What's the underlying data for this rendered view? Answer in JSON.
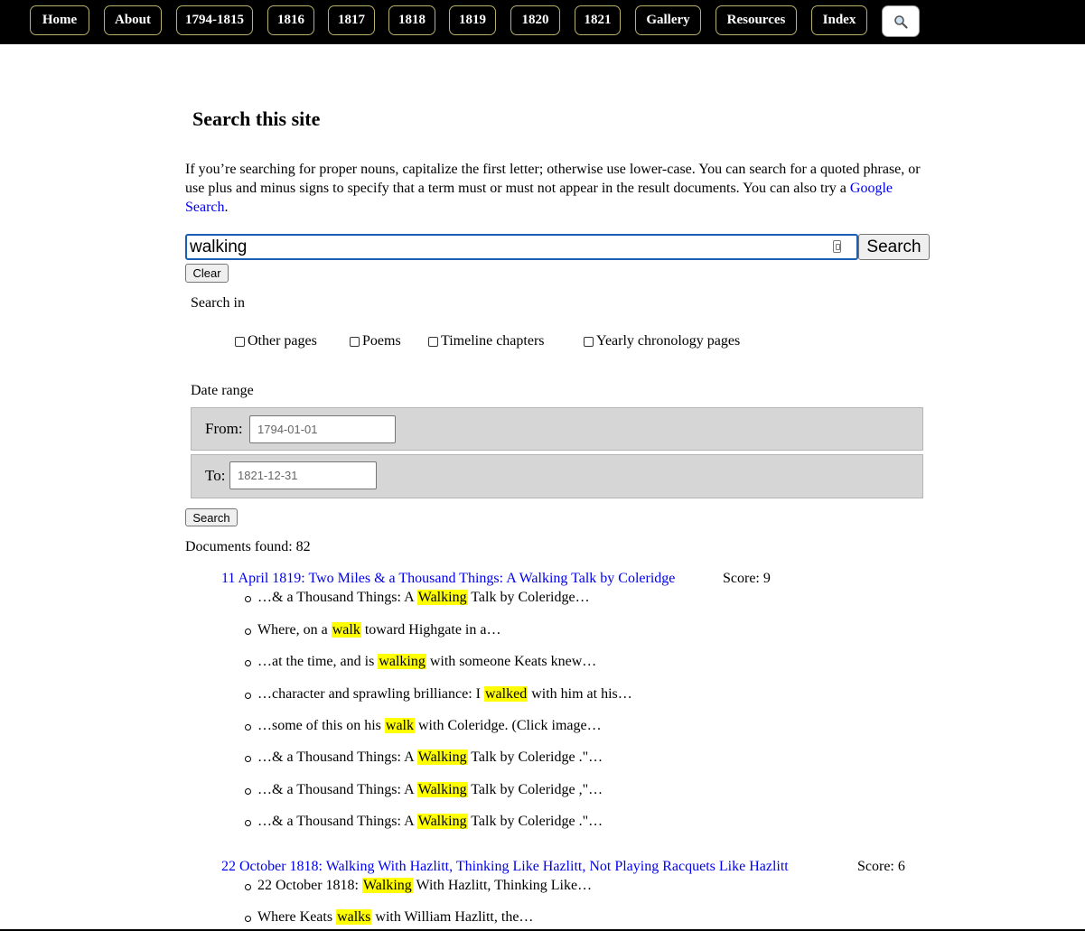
{
  "nav": {
    "items": [
      "Home",
      "About",
      "1794-1815",
      "1816",
      "1817",
      "1818",
      "1819",
      "1820",
      "1821",
      "Gallery",
      "Resources",
      "Index"
    ],
    "search_icon": "magnifier-icon"
  },
  "page": {
    "heading": "Search this site",
    "intro_text": "If you’re searching for proper nouns, capitalize the first letter; otherwise use lower-case. You can search for a quoted phrase, or use plus and minus signs to specify that a term must or must not appear in the result documents. You can also try a ",
    "intro_link": "Google Search",
    "intro_end": "."
  },
  "search": {
    "query": "walking",
    "search_button": "Search",
    "clear_button": "Clear"
  },
  "filters": {
    "search_in_label": "Search in",
    "options": [
      "Other pages",
      "Poems",
      "Timeline chapters",
      "Yearly chronology pages"
    ],
    "date_range_label": "Date range",
    "from_label": "From:",
    "from_placeholder": "1794-01-01",
    "to_label": "To:",
    "to_placeholder": "1821-12-31",
    "submit_button": "Search"
  },
  "results": {
    "count_text": "Documents found: 82",
    "items": [
      {
        "title": "11 April 1819: Two Miles & a Thousand Things: A Walking Talk by Coleridge",
        "score": "Score: 9",
        "snippets": [
          {
            "pre": "…& a Thousand Things: A ",
            "hit": "Walking",
            "post": " Talk by Coleridge…"
          },
          {
            "pre": "Where, on a ",
            "hit": "walk",
            "post": " toward Highgate in a…"
          },
          {
            "pre": "…at the time, and is ",
            "hit": "walking",
            "post": " with someone Keats knew…"
          },
          {
            "pre": "…character and sprawling brilliance: I ",
            "hit": "walked",
            "post": " with him at his…"
          },
          {
            "pre": "…some of this on his ",
            "hit": "walk",
            "post": " with Coleridge. (Click image…"
          },
          {
            "pre": "…& a Thousand Things: A ",
            "hit": "Walking",
            "post": " Talk by Coleridge .\"…"
          },
          {
            "pre": "…& a Thousand Things: A ",
            "hit": "Walking",
            "post": " Talk by Coleridge ,\"…"
          },
          {
            "pre": "…& a Thousand Things: A ",
            "hit": "Walking",
            "post": " Talk by Coleridge .\"…"
          }
        ]
      },
      {
        "title": "22 October 1818: Walking With Hazlitt, Thinking Like Hazlitt, Not Playing Racquets Like Hazlitt",
        "score": "Score: 6",
        "snippets": [
          {
            "pre": "22 October 1818: ",
            "hit": "Walking",
            "post": " With Hazlitt, Thinking Like…"
          },
          {
            "pre": "Where Keats ",
            "hit": "walks",
            "post": " with William Hazlitt, the…"
          }
        ]
      }
    ]
  }
}
